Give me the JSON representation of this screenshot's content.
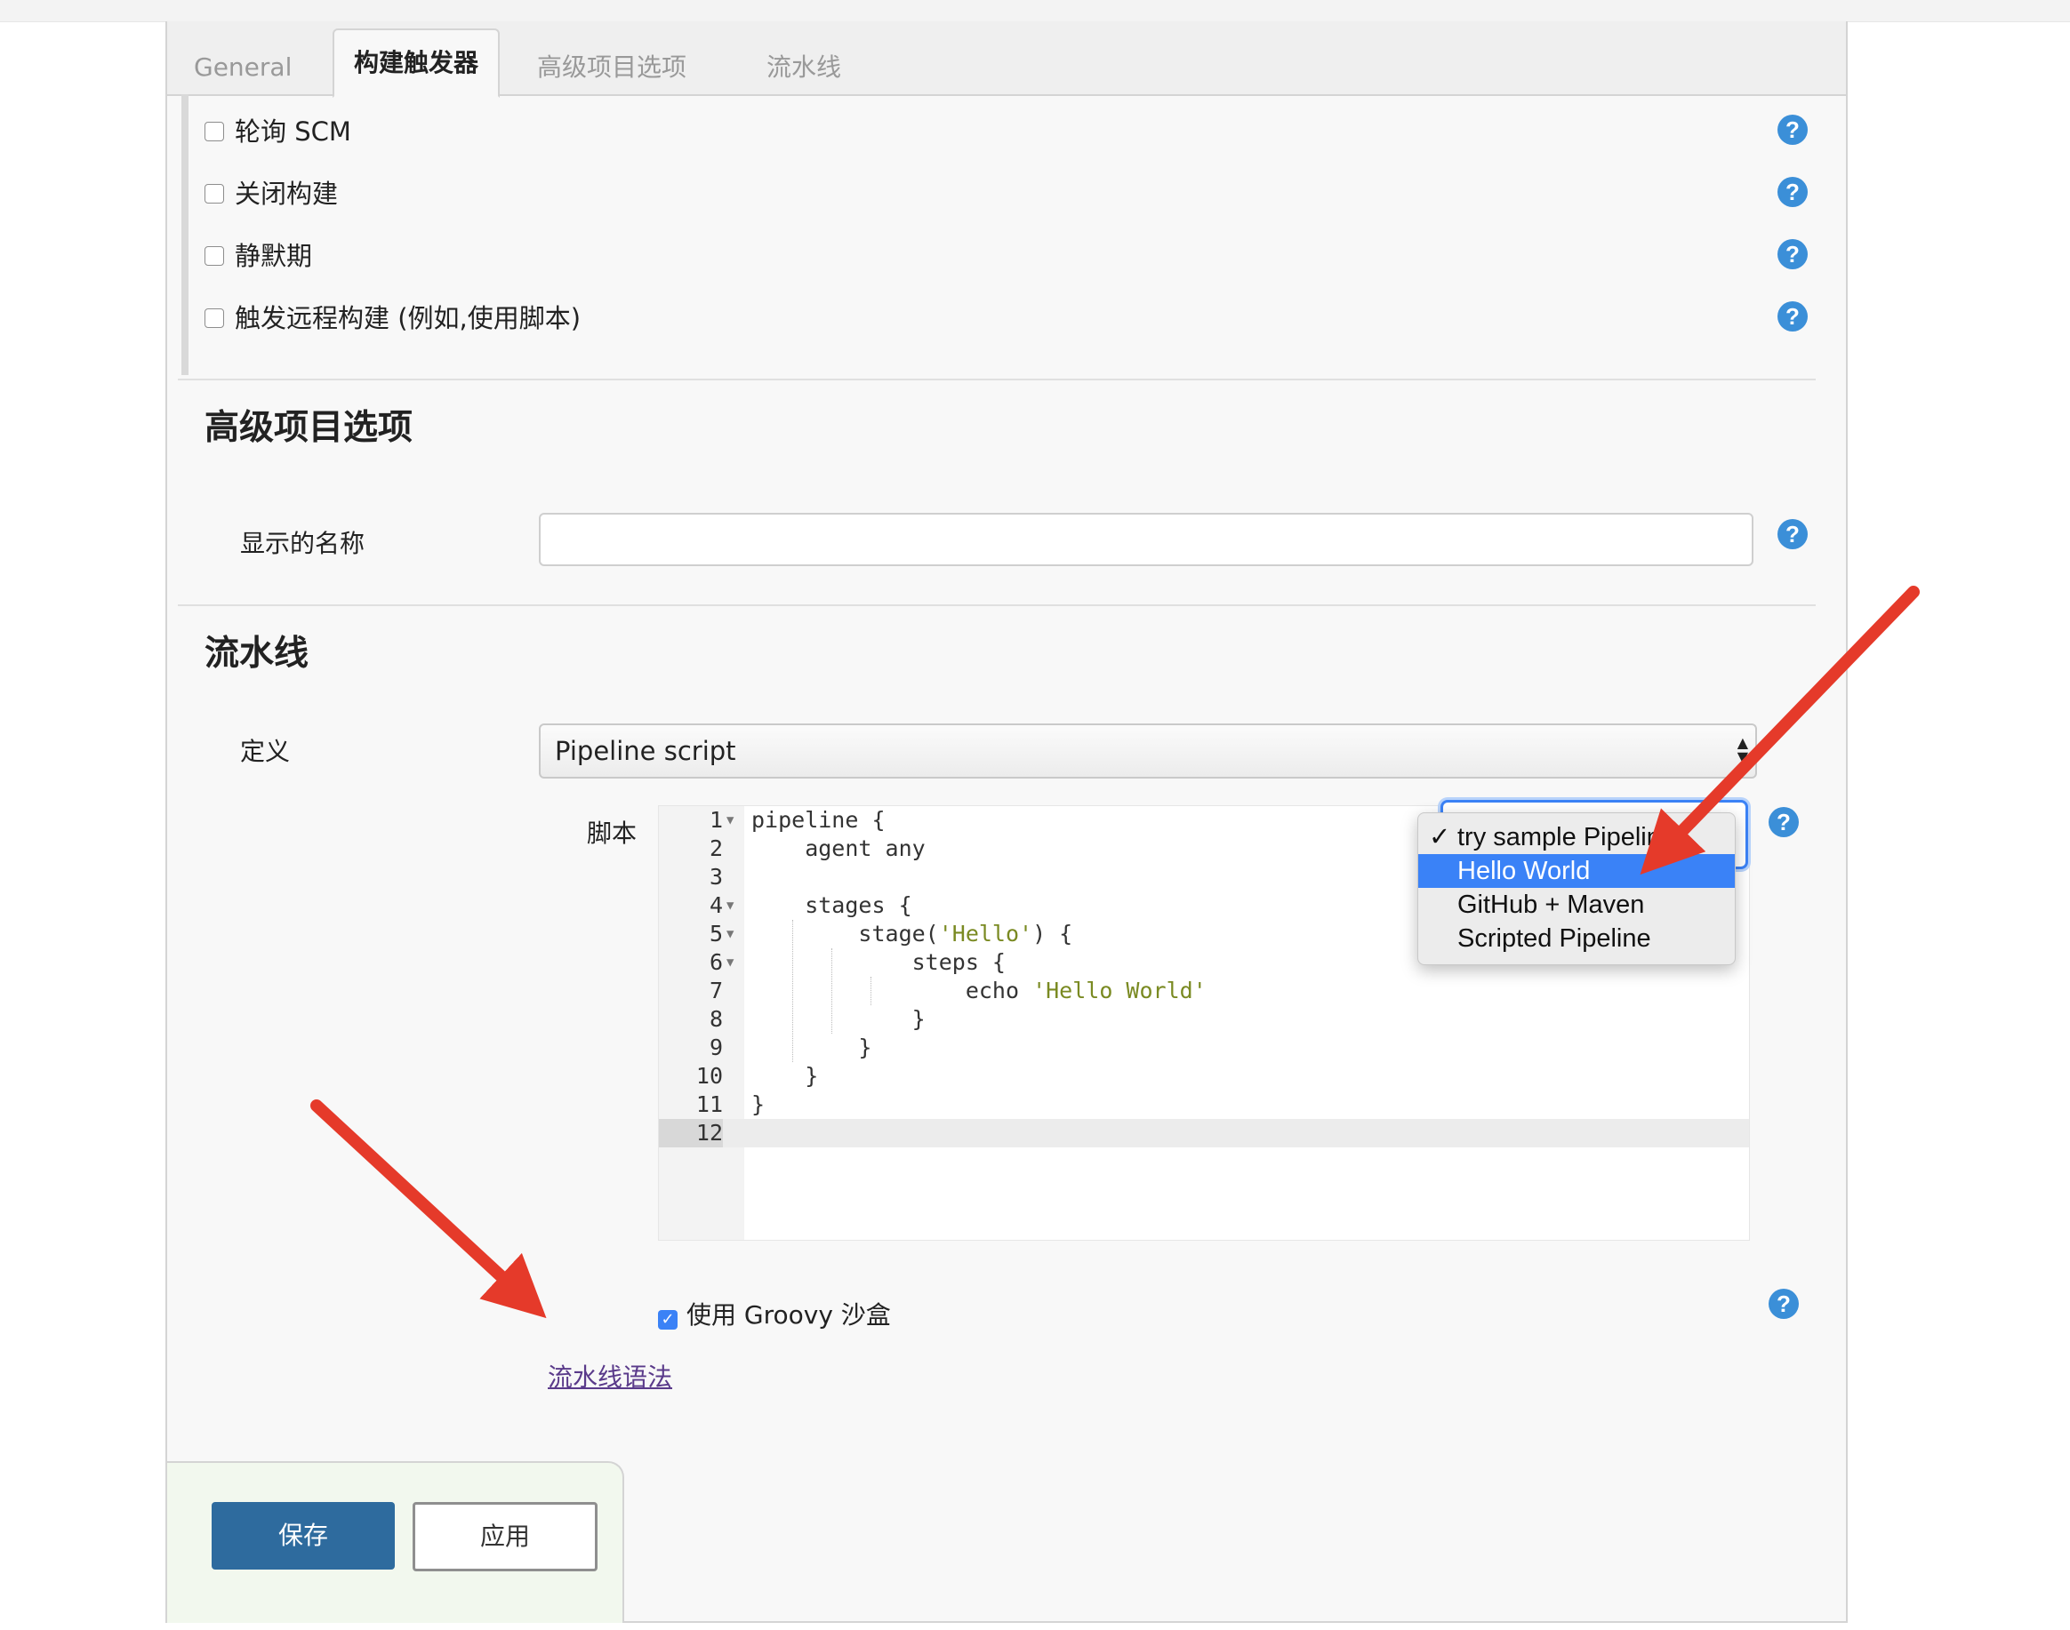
{
  "tabs": [
    {
      "label": "General",
      "active": false
    },
    {
      "label": "构建触发器",
      "active": true
    },
    {
      "label": "高级项目选项",
      "active": false
    },
    {
      "label": "流水线",
      "active": false
    }
  ],
  "triggers": [
    {
      "label": "轮询 SCM",
      "checked": false
    },
    {
      "label": "关闭构建",
      "checked": false
    },
    {
      "label": "静默期",
      "checked": false
    },
    {
      "label": "触发远程构建 (例如,使用脚本)",
      "checked": false
    }
  ],
  "advanced": {
    "title": "高级项目选项",
    "display_name_label": "显示的名称",
    "display_name_value": ""
  },
  "pipeline": {
    "title": "流水线",
    "definition_label": "定义",
    "definition_value": "Pipeline script",
    "script_label": "脚本",
    "code_lines": [
      "pipeline {",
      "    agent any",
      "",
      "    stages {",
      "        stage('Hello') {",
      "            steps {",
      "                echo 'Hello World'",
      "            }",
      "        }",
      "    }",
      "}",
      ""
    ],
    "line_numbers": [
      "1",
      "2",
      "3",
      "4",
      "5",
      "6",
      "7",
      "8",
      "9",
      "10",
      "11",
      "12"
    ],
    "foldable_lines": [
      1,
      4,
      5,
      6
    ],
    "active_line": 12,
    "groovy_sandbox_label": "使用 Groovy 沙盒",
    "groovy_sandbox_checked": true,
    "syntax_link": "流水线语法"
  },
  "sample_menu": {
    "items": [
      "try sample Pipeline...",
      "Hello World",
      "GitHub + Maven",
      "Scripted Pipeline"
    ],
    "checked_index": 0,
    "highlighted_index": 1,
    "check_glyph": "✓"
  },
  "buttons": {
    "save": "保存",
    "apply": "应用"
  },
  "help_glyph": "?",
  "colors": {
    "accent": "#3b8fd8",
    "save_button": "#2e6b9e",
    "menu_highlight": "#3a82f7",
    "annotation_arrow": "#e53a2a"
  }
}
